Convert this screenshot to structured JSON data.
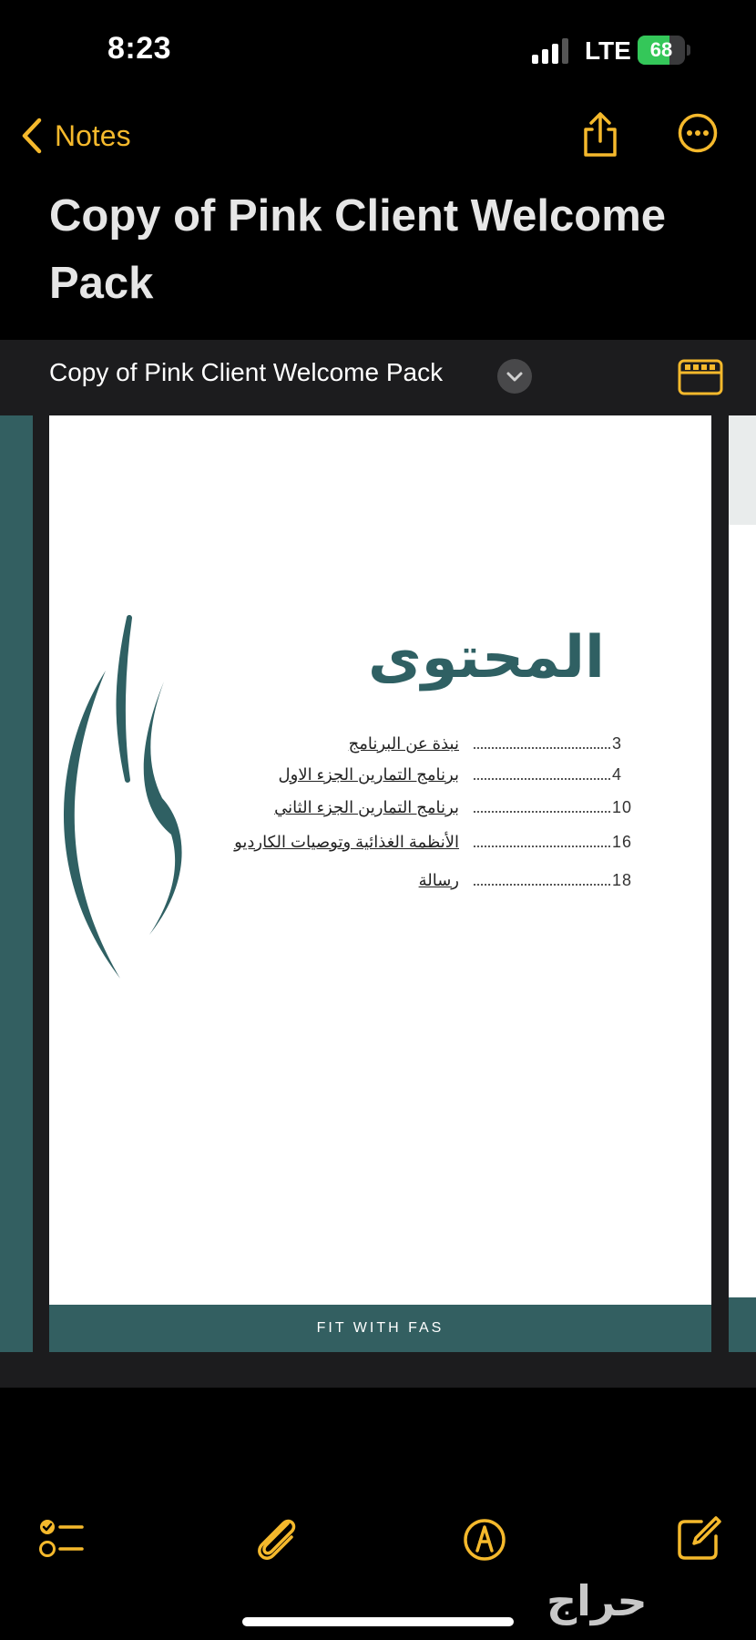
{
  "status_bar": {
    "time": "8:23",
    "carrier": "LTE",
    "battery_level": "68",
    "battery_charging": true,
    "signal_bars": 3
  },
  "nav": {
    "back_label": "Notes",
    "share_icon": "share-icon",
    "more_icon": "ellipsis-circle-icon",
    "accent_color": "#f5b92c"
  },
  "note": {
    "title": "Copy of Pink Client Welcome Pack"
  },
  "attachment": {
    "name": "Copy of Pink Client Welcome Pack",
    "chevron_icon": "chevron-down-icon",
    "grid_icon": "page-grid-icon",
    "page": {
      "heading": "المحتوى",
      "toc": [
        {
          "text": "نبذة عن البرنامج",
          "page": "3"
        },
        {
          "text": "برنامج التمارين الجزء الاول",
          "page": "4"
        },
        {
          "text": "برنامج التمارين الجزء الثاني",
          "page": "10"
        },
        {
          "text": "الأنظمة الغذائية وتوصيات الكارديو",
          "page": "16"
        },
        {
          "text": "رسالة",
          "page": "18"
        }
      ],
      "footer": "FIT WITH FAS",
      "theme_color": "#335f61"
    }
  },
  "toolbar": {
    "items": [
      "checklist-icon",
      "attachment-icon",
      "markup-icon",
      "compose-icon"
    ]
  },
  "watermark": "حراج"
}
